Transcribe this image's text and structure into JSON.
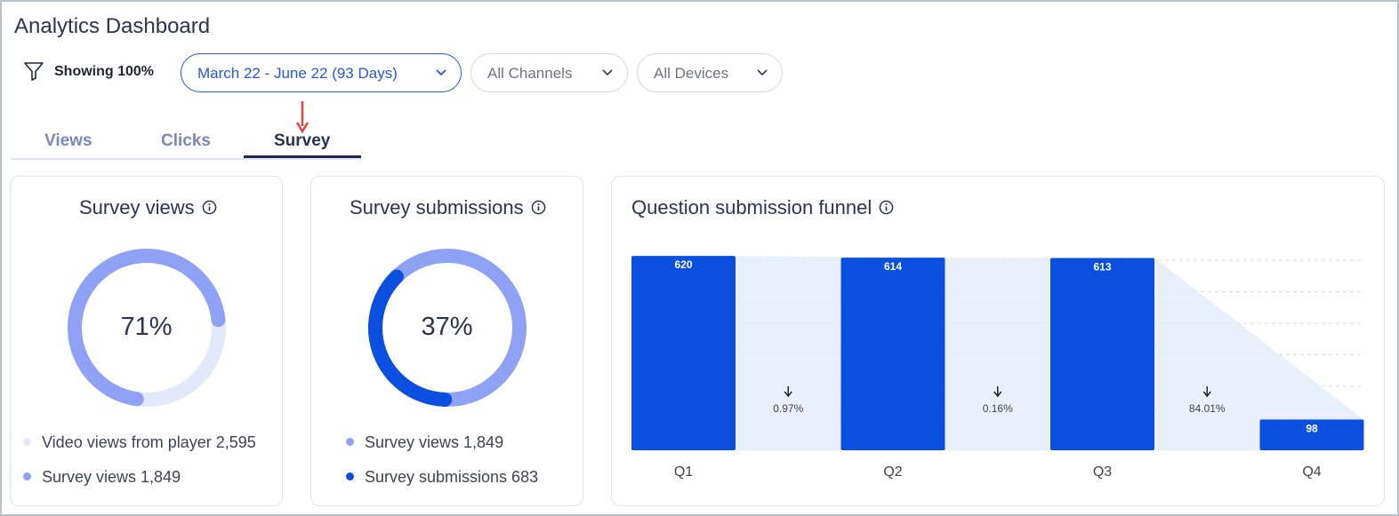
{
  "header": {
    "title": "Analytics Dashboard"
  },
  "filters": {
    "showing": "Showing 100%",
    "date_range": "March 22 - June 22 (93 Days)",
    "channels": "All Channels",
    "devices": "All Devices"
  },
  "tabs": [
    {
      "label": "Views",
      "active": false
    },
    {
      "label": "Clicks",
      "active": false
    },
    {
      "label": "Survey",
      "active": true
    }
  ],
  "survey_views": {
    "title": "Survey views",
    "percent_label": "71%",
    "percent": 71,
    "legend": [
      {
        "label": "Video views from player 2,595",
        "color": "#e3e9fb"
      },
      {
        "label": "Survey views 1,849",
        "color": "#8fa1f5"
      }
    ]
  },
  "survey_submissions": {
    "title": "Survey submissions",
    "percent_label": "37%",
    "percent": 37,
    "legend": [
      {
        "label": "Survey views 1,849",
        "color": "#8fa1f5"
      },
      {
        "label": "Survey submissions 683",
        "color": "#0a4fe0"
      }
    ]
  },
  "funnel": {
    "title": "Question submission funnel",
    "bar_color": "#0a4fe0",
    "fill_color": "#e3e9fb"
  },
  "chart_data": {
    "type": "bar",
    "categories": [
      "Q1",
      "Q2",
      "Q3",
      "Q4"
    ],
    "values": [
      620,
      614,
      613,
      98
    ],
    "dropoffs": [
      "0.97%",
      "0.16%",
      "84.01%"
    ],
    "ylim": [
      0,
      640
    ],
    "grid": true
  },
  "colors": {
    "accent": "#2556e0",
    "ring_light": "#e3e9fb",
    "ring_mid": "#8fa1f5",
    "ring_dark": "#0a4fe0",
    "annotation_arrow": "#e8413e"
  }
}
